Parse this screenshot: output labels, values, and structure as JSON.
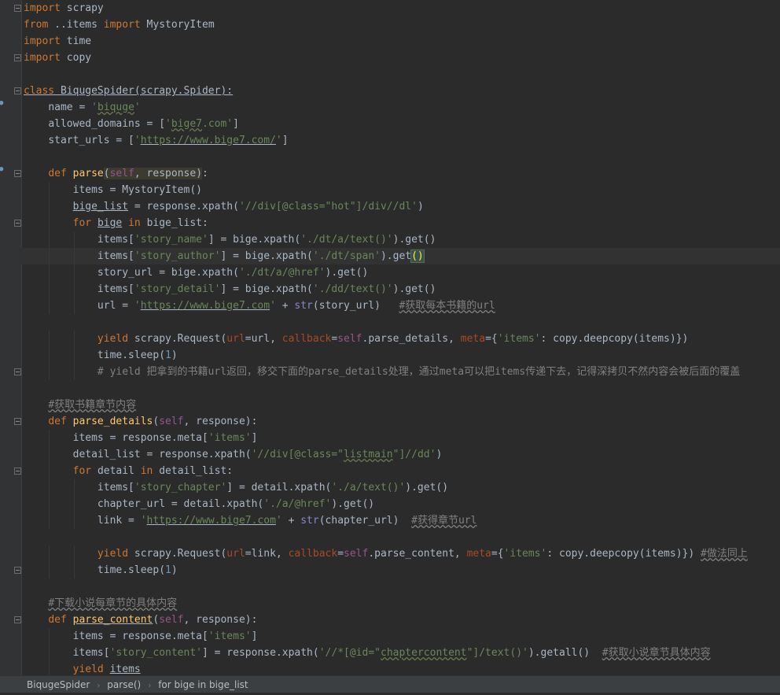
{
  "editor": {
    "lines": [
      {
        "indent": 0,
        "tokens": [
          {
            "c": "kw",
            "t": "import"
          },
          {
            "c": "",
            "t": " scrapy"
          }
        ]
      },
      {
        "indent": 0,
        "tokens": [
          {
            "c": "kw",
            "t": "from"
          },
          {
            "c": "",
            "t": " ..items "
          },
          {
            "c": "kw",
            "t": "import"
          },
          {
            "c": "",
            "t": " MystoryItem"
          }
        ]
      },
      {
        "indent": 0,
        "tokens": [
          {
            "c": "kw",
            "t": "import"
          },
          {
            "c": "",
            "t": " time"
          }
        ]
      },
      {
        "indent": 0,
        "tokens": [
          {
            "c": "kw",
            "t": "import"
          },
          {
            "c": "",
            "t": " copy"
          }
        ]
      },
      {
        "indent": 0,
        "tokens": []
      },
      {
        "indent": 0,
        "tokens": [
          {
            "c": "kw u",
            "t": "class"
          },
          {
            "c": "u",
            "t": " BiqugeSpider(scrapy.Spider):"
          }
        ]
      },
      {
        "indent": 1,
        "tokens": [
          {
            "c": "",
            "t": "name = "
          },
          {
            "c": "str",
            "t": "'"
          },
          {
            "c": "str wavy",
            "t": "biquge"
          },
          {
            "c": "str",
            "t": "'"
          }
        ]
      },
      {
        "indent": 1,
        "tokens": [
          {
            "c": "",
            "t": "allowed_domains = ["
          },
          {
            "c": "str",
            "t": "'"
          },
          {
            "c": "str wavy",
            "t": "bige7"
          },
          {
            "c": "str",
            "t": ".com'"
          },
          {
            "c": "",
            "t": "]"
          }
        ]
      },
      {
        "indent": 1,
        "tokens": [
          {
            "c": "",
            "t": "start_urls = ["
          },
          {
            "c": "str",
            "t": "'"
          },
          {
            "c": "str u",
            "t": "https://www.bige7.com/"
          },
          {
            "c": "str",
            "t": "'"
          },
          {
            "c": "",
            "t": "]"
          }
        ]
      },
      {
        "indent": 0,
        "tokens": []
      },
      {
        "indent": 1,
        "tokens": [
          {
            "c": "kw",
            "t": "def "
          },
          {
            "c": "fn",
            "t": "parse"
          },
          {
            "c": "hl2",
            "t": "("
          },
          {
            "c": "self hl2",
            "t": "self"
          },
          {
            "c": "hl2",
            "t": ", response"
          },
          {
            "c": "hl2",
            "t": ")"
          },
          {
            "c": "",
            "t": ":"
          }
        ]
      },
      {
        "indent": 2,
        "tokens": [
          {
            "c": "",
            "t": "items = MystoryItem()"
          }
        ]
      },
      {
        "indent": 2,
        "tokens": [
          {
            "c": "u",
            "t": "bige_list"
          },
          {
            "c": "",
            "t": " = response.xpath("
          },
          {
            "c": "str",
            "t": "'//div[@class=\"hot\"]/div//dl'"
          },
          {
            "c": "",
            "t": ")"
          }
        ]
      },
      {
        "indent": 2,
        "tokens": [
          {
            "c": "kw",
            "t": "for "
          },
          {
            "c": "u",
            "t": "bige"
          },
          {
            "c": "kw",
            "t": " in "
          },
          {
            "c": "",
            "t": "bige_list:"
          }
        ]
      },
      {
        "indent": 3,
        "tokens": [
          {
            "c": "",
            "t": "items["
          },
          {
            "c": "str",
            "t": "'story_name'"
          },
          {
            "c": "",
            "t": "] = bige.xpath("
          },
          {
            "c": "str",
            "t": "'./dt/a/text()'"
          },
          {
            "c": "",
            "t": ").get()"
          }
        ]
      },
      {
        "indent": 3,
        "current": true,
        "tokens": [
          {
            "c": "",
            "t": "items["
          },
          {
            "c": "str",
            "t": "'story_author'"
          },
          {
            "c": "",
            "t": "] = bige.xpath("
          },
          {
            "c": "str",
            "t": "'./dt/span'"
          },
          {
            "c": "",
            "t": ").get"
          },
          {
            "c": "match",
            "t": "()"
          }
        ]
      },
      {
        "indent": 3,
        "tokens": [
          {
            "c": "",
            "t": "story_url = bige.xpath("
          },
          {
            "c": "str",
            "t": "'./dt/a/@href'"
          },
          {
            "c": "",
            "t": ").get()"
          }
        ]
      },
      {
        "indent": 3,
        "tokens": [
          {
            "c": "",
            "t": "items["
          },
          {
            "c": "str",
            "t": "'story_detail'"
          },
          {
            "c": "",
            "t": "] = bige.xpath("
          },
          {
            "c": "str",
            "t": "'./dd/text()'"
          },
          {
            "c": "",
            "t": ").get()"
          }
        ]
      },
      {
        "indent": 3,
        "tokens": [
          {
            "c": "",
            "t": "url = "
          },
          {
            "c": "str",
            "t": "'"
          },
          {
            "c": "str u",
            "t": "https://www.bige7.com"
          },
          {
            "c": "str",
            "t": "'"
          },
          {
            "c": "",
            "t": " + "
          },
          {
            "c": "bi",
            "t": "str"
          },
          {
            "c": "",
            "t": "(story_url)   "
          },
          {
            "c": "cmt wavy2",
            "t": "#获取每本书籍的url"
          }
        ]
      },
      {
        "indent": 0,
        "tokens": []
      },
      {
        "indent": 3,
        "tokens": [
          {
            "c": "kw",
            "t": "yield "
          },
          {
            "c": "",
            "t": "scrapy.Request("
          },
          {
            "c": "param",
            "t": "url"
          },
          {
            "c": "",
            "t": "=url, "
          },
          {
            "c": "param",
            "t": "callback"
          },
          {
            "c": "",
            "t": "="
          },
          {
            "c": "self",
            "t": "self"
          },
          {
            "c": "",
            "t": ".parse_details, "
          },
          {
            "c": "param",
            "t": "meta"
          },
          {
            "c": "",
            "t": "={"
          },
          {
            "c": "str",
            "t": "'items'"
          },
          {
            "c": "",
            "t": ": copy.deepcopy(items)})"
          }
        ]
      },
      {
        "indent": 3,
        "tokens": [
          {
            "c": "",
            "t": "time.sleep("
          },
          {
            "c": "num",
            "t": "1"
          },
          {
            "c": "",
            "t": ")"
          }
        ]
      },
      {
        "indent": 3,
        "tokens": [
          {
            "c": "cmt",
            "t": "# yield 把拿到的书籍url返回，移交下面的parse_details处理，通过meta可以把items传递下去，记得深拷贝不然内容会被后面的覆盖"
          }
        ]
      },
      {
        "indent": 0,
        "tokens": []
      },
      {
        "indent": 1,
        "tokens": [
          {
            "c": "cmt wavy2",
            "t": "#获取书籍章节内容"
          }
        ]
      },
      {
        "indent": 1,
        "tokens": [
          {
            "c": "kw",
            "t": "def "
          },
          {
            "c": "fn",
            "t": "parse_details"
          },
          {
            "c": "",
            "t": "("
          },
          {
            "c": "self",
            "t": "self"
          },
          {
            "c": "",
            "t": ", response):"
          }
        ]
      },
      {
        "indent": 2,
        "tokens": [
          {
            "c": "",
            "t": "items = response.meta["
          },
          {
            "c": "str",
            "t": "'items'"
          },
          {
            "c": "",
            "t": "]"
          }
        ]
      },
      {
        "indent": 2,
        "tokens": [
          {
            "c": "",
            "t": "detail_list = response.xpath("
          },
          {
            "c": "str",
            "t": "'//div[@class=\""
          },
          {
            "c": "str wavy",
            "t": "listmain"
          },
          {
            "c": "str",
            "t": "\"]//dd'"
          },
          {
            "c": "",
            "t": ")"
          }
        ]
      },
      {
        "indent": 2,
        "tokens": [
          {
            "c": "kw",
            "t": "for "
          },
          {
            "c": "",
            "t": "detail "
          },
          {
            "c": "kw",
            "t": "in "
          },
          {
            "c": "",
            "t": "detail_list:"
          }
        ]
      },
      {
        "indent": 3,
        "tokens": [
          {
            "c": "",
            "t": "items["
          },
          {
            "c": "str",
            "t": "'story_chapter'"
          },
          {
            "c": "",
            "t": "] = detail.xpath("
          },
          {
            "c": "str",
            "t": "'./a/text()'"
          },
          {
            "c": "",
            "t": ").get()"
          }
        ]
      },
      {
        "indent": 3,
        "tokens": [
          {
            "c": "",
            "t": "chapter_url = detail.xpath("
          },
          {
            "c": "str",
            "t": "'./a/@href'"
          },
          {
            "c": "",
            "t": ").get()"
          }
        ]
      },
      {
        "indent": 3,
        "tokens": [
          {
            "c": "",
            "t": "link = "
          },
          {
            "c": "str",
            "t": "'"
          },
          {
            "c": "str u",
            "t": "https://www.bige7.com"
          },
          {
            "c": "str",
            "t": "'"
          },
          {
            "c": "",
            "t": " + "
          },
          {
            "c": "bi",
            "t": "str"
          },
          {
            "c": "",
            "t": "(chapter_url)  "
          },
          {
            "c": "cmt wavy2",
            "t": "#获得章节url"
          }
        ]
      },
      {
        "indent": 0,
        "tokens": []
      },
      {
        "indent": 3,
        "tokens": [
          {
            "c": "kw",
            "t": "yield "
          },
          {
            "c": "",
            "t": "scrapy.Request("
          },
          {
            "c": "param",
            "t": "url"
          },
          {
            "c": "",
            "t": "=link, "
          },
          {
            "c": "param",
            "t": "callback"
          },
          {
            "c": "",
            "t": "="
          },
          {
            "c": "self",
            "t": "self"
          },
          {
            "c": "",
            "t": ".parse_content, "
          },
          {
            "c": "param",
            "t": "meta"
          },
          {
            "c": "",
            "t": "={"
          },
          {
            "c": "str",
            "t": "'items'"
          },
          {
            "c": "",
            "t": ": copy.deepcopy(items)}) "
          },
          {
            "c": "cmt wavy2",
            "t": "#做法同上"
          }
        ]
      },
      {
        "indent": 3,
        "tokens": [
          {
            "c": "",
            "t": "time.sleep("
          },
          {
            "c": "num",
            "t": "1"
          },
          {
            "c": "",
            "t": ")"
          }
        ]
      },
      {
        "indent": 0,
        "tokens": []
      },
      {
        "indent": 1,
        "tokens": [
          {
            "c": "cmt wavy2",
            "t": "#下载小说每章节的具体内容"
          }
        ]
      },
      {
        "indent": 1,
        "tokens": [
          {
            "c": "kw",
            "t": "def "
          },
          {
            "c": "fn u",
            "t": "parse_content"
          },
          {
            "c": "",
            "t": "("
          },
          {
            "c": "self",
            "t": "self"
          },
          {
            "c": "",
            "t": ", response):"
          }
        ]
      },
      {
        "indent": 2,
        "tokens": [
          {
            "c": "",
            "t": "items = response.meta["
          },
          {
            "c": "str",
            "t": "'items'"
          },
          {
            "c": "",
            "t": "]"
          }
        ]
      },
      {
        "indent": 2,
        "tokens": [
          {
            "c": "",
            "t": "items["
          },
          {
            "c": "str",
            "t": "'story_content'"
          },
          {
            "c": "",
            "t": "] = response.xpath("
          },
          {
            "c": "str",
            "t": "'//*[@id=\""
          },
          {
            "c": "str wavy",
            "t": "chaptercontent"
          },
          {
            "c": "str",
            "t": "\"]/text()'"
          },
          {
            "c": "",
            "t": ").getall()  "
          },
          {
            "c": "cmt wavy2",
            "t": "#获取小说章节具体内容"
          }
        ]
      },
      {
        "indent": 2,
        "tokens": [
          {
            "c": "kw",
            "t": "yield "
          },
          {
            "c": "u",
            "t": "items"
          }
        ]
      }
    ]
  },
  "breadcrumb": {
    "items": [
      "BiqugeSpider",
      "parse()",
      "for bige in bige_list"
    ],
    "separator": "›"
  },
  "colors": {
    "background": "#2b2b2b",
    "keyword": "#cc7832",
    "string": "#6a8759",
    "comment": "#808080",
    "function": "#ffc66d",
    "self": "#94558d",
    "number": "#6897bb"
  }
}
